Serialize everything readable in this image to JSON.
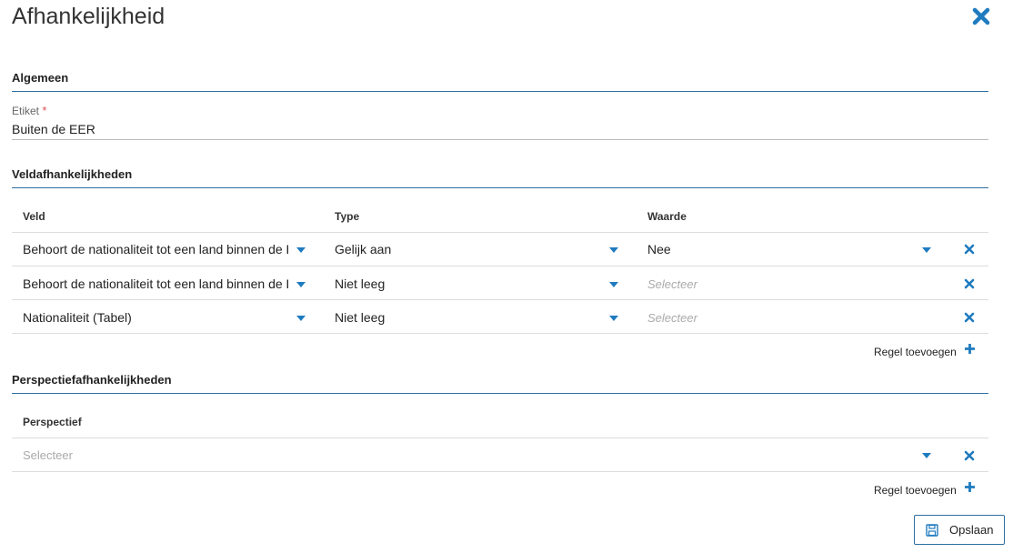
{
  "dialog": {
    "title": "Afhankelijkheid"
  },
  "general": {
    "section_title": "Algemeen",
    "label_field": {
      "label": "Etiket",
      "required_marker": "*",
      "value": "Buiten de EER"
    }
  },
  "field_dependencies": {
    "section_title": "Veldafhankelijkheden",
    "columns": [
      "Veld",
      "Type",
      "Waarde"
    ],
    "rows": [
      {
        "field": "Behoort de nationaliteit tot een land binnen de EER?",
        "type": "Gelijk aan",
        "value": "Nee",
        "value_is_placeholder": false
      },
      {
        "field": "Behoort de nationaliteit tot een land binnen de EER?",
        "type": "Niet leeg",
        "value": "Selecteer",
        "value_is_placeholder": true
      },
      {
        "field": "Nationaliteit (Tabel)",
        "type": "Niet leeg",
        "value": "Selecteer",
        "value_is_placeholder": true
      }
    ],
    "add_row_label": "Regel toevoegen"
  },
  "perspective_dependencies": {
    "section_title": "Perspectiefafhankelijkheden",
    "columns": [
      "Perspectief"
    ],
    "rows": [
      {
        "perspective": "Selecteer",
        "is_placeholder": true
      }
    ],
    "add_row_label": "Regel toevoegen"
  },
  "save_button": {
    "label": "Opslaan",
    "icon": "floppy-disk-icon"
  },
  "colors": {
    "accent": "#1f7bbf",
    "section_rule": "#2f6f9f",
    "required": "#d9534f"
  }
}
